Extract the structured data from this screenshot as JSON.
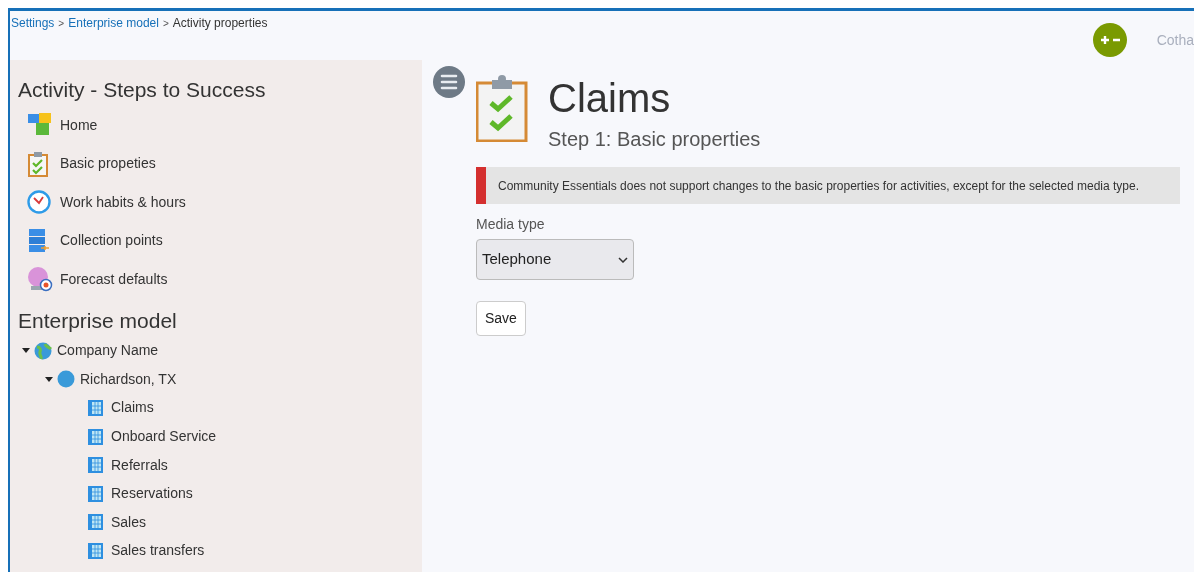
{
  "breadcrumb_separator": ">",
  "breadcrumb": [
    {
      "label": "Settings",
      "link": true
    },
    {
      "label": "Enterprise model",
      "link": true
    },
    {
      "label": "Activity properties",
      "link": false
    }
  ],
  "top_right": {
    "label": "Cotha"
  },
  "sidebar": {
    "title": "Activity - Steps to Success",
    "items": [
      {
        "label": "Home"
      },
      {
        "label": "Basic propeties"
      },
      {
        "label": "Work habits & hours"
      },
      {
        "label": "Collection points"
      },
      {
        "label": "Forecast defaults"
      }
    ],
    "tree_title": "Enterprise model",
    "tree": [
      {
        "label": "Company Name",
        "kind": "company",
        "expanded": true,
        "children": [
          {
            "label": "Richardson, TX",
            "kind": "site",
            "expanded": true,
            "children": [
              {
                "label": "Claims",
                "kind": "activity"
              },
              {
                "label": "Onboard Service",
                "kind": "activity"
              },
              {
                "label": "Referrals",
                "kind": "activity"
              },
              {
                "label": "Reservations",
                "kind": "activity"
              },
              {
                "label": "Sales",
                "kind": "activity"
              },
              {
                "label": "Sales transfers",
                "kind": "activity"
              }
            ]
          }
        ]
      }
    ]
  },
  "main": {
    "title": "Claims",
    "subtitle": "Step 1: Basic properties",
    "notice": "Community Essentials does not support changes to the basic properties for activities, except for the selected media type.",
    "media_type": {
      "label": "Media type",
      "value": "Telephone"
    },
    "save": "Save"
  }
}
